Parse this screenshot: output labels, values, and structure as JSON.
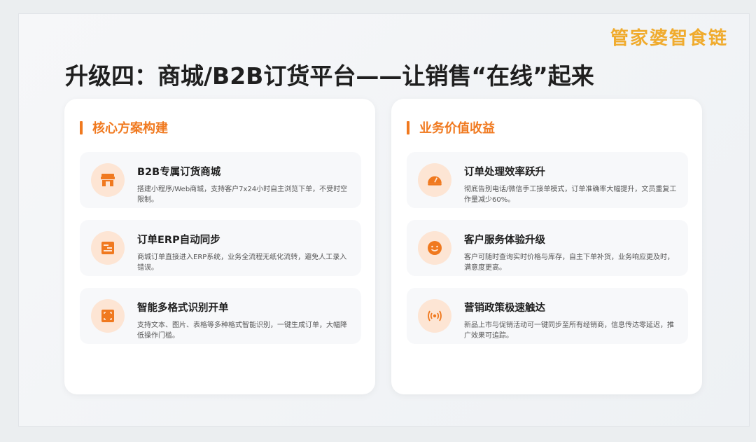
{
  "brand": "管家婆智食链",
  "title": "升级四：商城/B2B订货平台——让销售“在线”起来",
  "left_panel": {
    "heading": "核心方案构建",
    "items": [
      {
        "title": "B2B专属订货商城",
        "desc": "搭建小程序/Web商城，支持客户7x24小时自主浏览下单，不受时空限制。",
        "icon": "storefront-icon"
      },
      {
        "title": "订单ERP自动同步",
        "desc": "商城订单直接进入ERP系统，业务全流程无纸化流转，避免人工录入错误。",
        "icon": "sync-doc-icon"
      },
      {
        "title": "智能多格式识别开单",
        "desc": "支持文本、图片、表格等多种格式智能识别，一键生成订单，大幅降低操作门槛。",
        "icon": "scan-icon"
      }
    ]
  },
  "right_panel": {
    "heading": "业务价值收益",
    "items": [
      {
        "title": "订单处理效率跃升",
        "desc": "彻底告别电话/微信手工接单模式，订单准确率大幅提升，文员重复工作量减少60%。",
        "icon": "gauge-icon"
      },
      {
        "title": "客户服务体验升级",
        "desc": "客户可随时查询实时价格与库存，自主下单补货，业务响应更及时，满意度更高。",
        "icon": "smile-icon"
      },
      {
        "title": "营销政策极速触达",
        "desc": "新品上市与促销活动可一键同步至所有经销商，信息传达零延迟，推广效果可追踪。",
        "icon": "broadcast-icon"
      }
    ]
  },
  "colors": {
    "accent": "#f0791f",
    "brand": "#f0ab2d",
    "icon_bg": "#fde5d4"
  }
}
